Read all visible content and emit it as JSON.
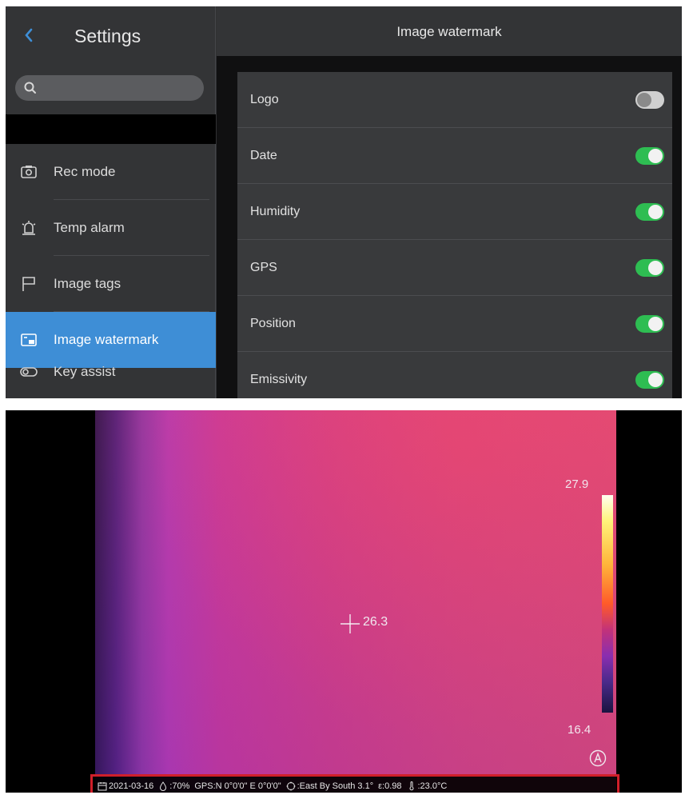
{
  "settings_screen": {
    "sidebar": {
      "title": "Settings",
      "back_icon": "chevron-left-icon",
      "search": {
        "icon": "search-icon",
        "placeholder": ""
      },
      "items": [
        {
          "label": "Rec mode",
          "icon": "camera-icon",
          "active": false
        },
        {
          "label": "Temp alarm",
          "icon": "alarm-icon",
          "active": false
        },
        {
          "label": "Image tags",
          "icon": "flag-icon",
          "active": false
        },
        {
          "label": "Image watermark",
          "icon": "watermark-icon",
          "active": true
        },
        {
          "label": "Key assist",
          "icon": "key-assist-icon",
          "active": false
        }
      ]
    },
    "content": {
      "title": "Image watermark",
      "toggles": [
        {
          "label": "Logo",
          "on": false
        },
        {
          "label": "Date",
          "on": true
        },
        {
          "label": "Humidity",
          "on": true
        },
        {
          "label": "GPS",
          "on": true
        },
        {
          "label": "Position",
          "on": true
        },
        {
          "label": "Emissivity",
          "on": true
        }
      ]
    },
    "colors": {
      "accent": "#3e8ed6",
      "toggle_on": "#2ebd52",
      "background": "#303133"
    }
  },
  "thermal_view": {
    "spot_temperature": "26.3",
    "scale_max": "27.9",
    "scale_min": "16.4",
    "auto_mode_icon": "auto-a-icon",
    "watermark": {
      "date": "2021-03-16",
      "humidity": ":70%",
      "gps": "GPS:N 0°0'0\" E 0°0'0\"",
      "position": ":East By South 3.1°",
      "emissivity": "ε:0.98",
      "temperature": ":23.0°C"
    },
    "watermark_highlight_color": "#d01f2a"
  }
}
